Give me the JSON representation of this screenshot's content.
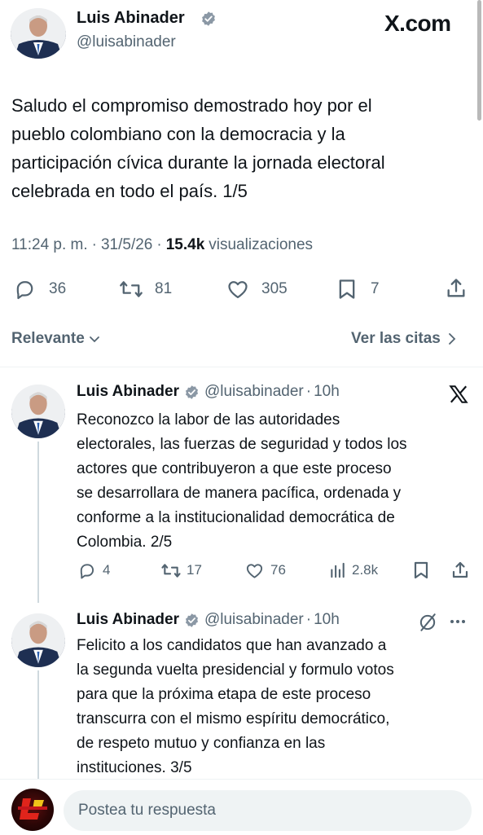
{
  "site": {
    "domain": "X.com"
  },
  "main_post": {
    "author_name": "Luis Abinader",
    "author_handle": "@luisabinader",
    "text_lines": [
      "Saludo el compromiso demostrado hoy por el",
      "pueblo colombiano con la democracia y la",
      "participación cívica durante la jornada electoral",
      "celebrada en todo el país. 1/5"
    ],
    "time": "11:24 p. m.",
    "sep": "·",
    "date": "31/5/26",
    "views_count": "15.4k",
    "views_label": "visualizaciones",
    "replies": "36",
    "reposts": "81",
    "likes": "305",
    "bookmarks": "7"
  },
  "sort": {
    "relevant": "Relevante",
    "quotes": "Ver las citas"
  },
  "replies": [
    {
      "name": "Luis Abinader",
      "handle": "@luisabinader",
      "dot": "·",
      "time": "10h",
      "text_lines": [
        "Reconozco la labor de las autoridades",
        "electorales, las fuerzas de seguridad y todos los",
        "actores que contribuyeron a que este proceso",
        "se desarrollara de manera pacífica, ordenada y",
        "conforme a la institucionalidad democrática de",
        "Colombia. 2/5"
      ],
      "replies": "4",
      "reposts": "17",
      "likes": "76",
      "views": "2.8k"
    },
    {
      "name": "Luis Abinader",
      "handle": "@luisabinader",
      "dot": "·",
      "time": "10h",
      "text_lines": [
        "Felicito a los candidatos que han avanzado a",
        "la segunda vuelta presidencial y formulo votos",
        "para que la próxima etapa de este proceso",
        "transcurra con el mismo espíritu democrático,",
        "de respeto mutuo y confianza en las",
        "instituciones. 3/5"
      ]
    }
  ],
  "composer": {
    "placeholder": "Postea tu respuesta"
  },
  "colors": {
    "verified": "#1d9bf0",
    "text": "#0f1419",
    "muted": "#536471",
    "line": "#cfd9de",
    "input_bg": "#eff3f4"
  }
}
